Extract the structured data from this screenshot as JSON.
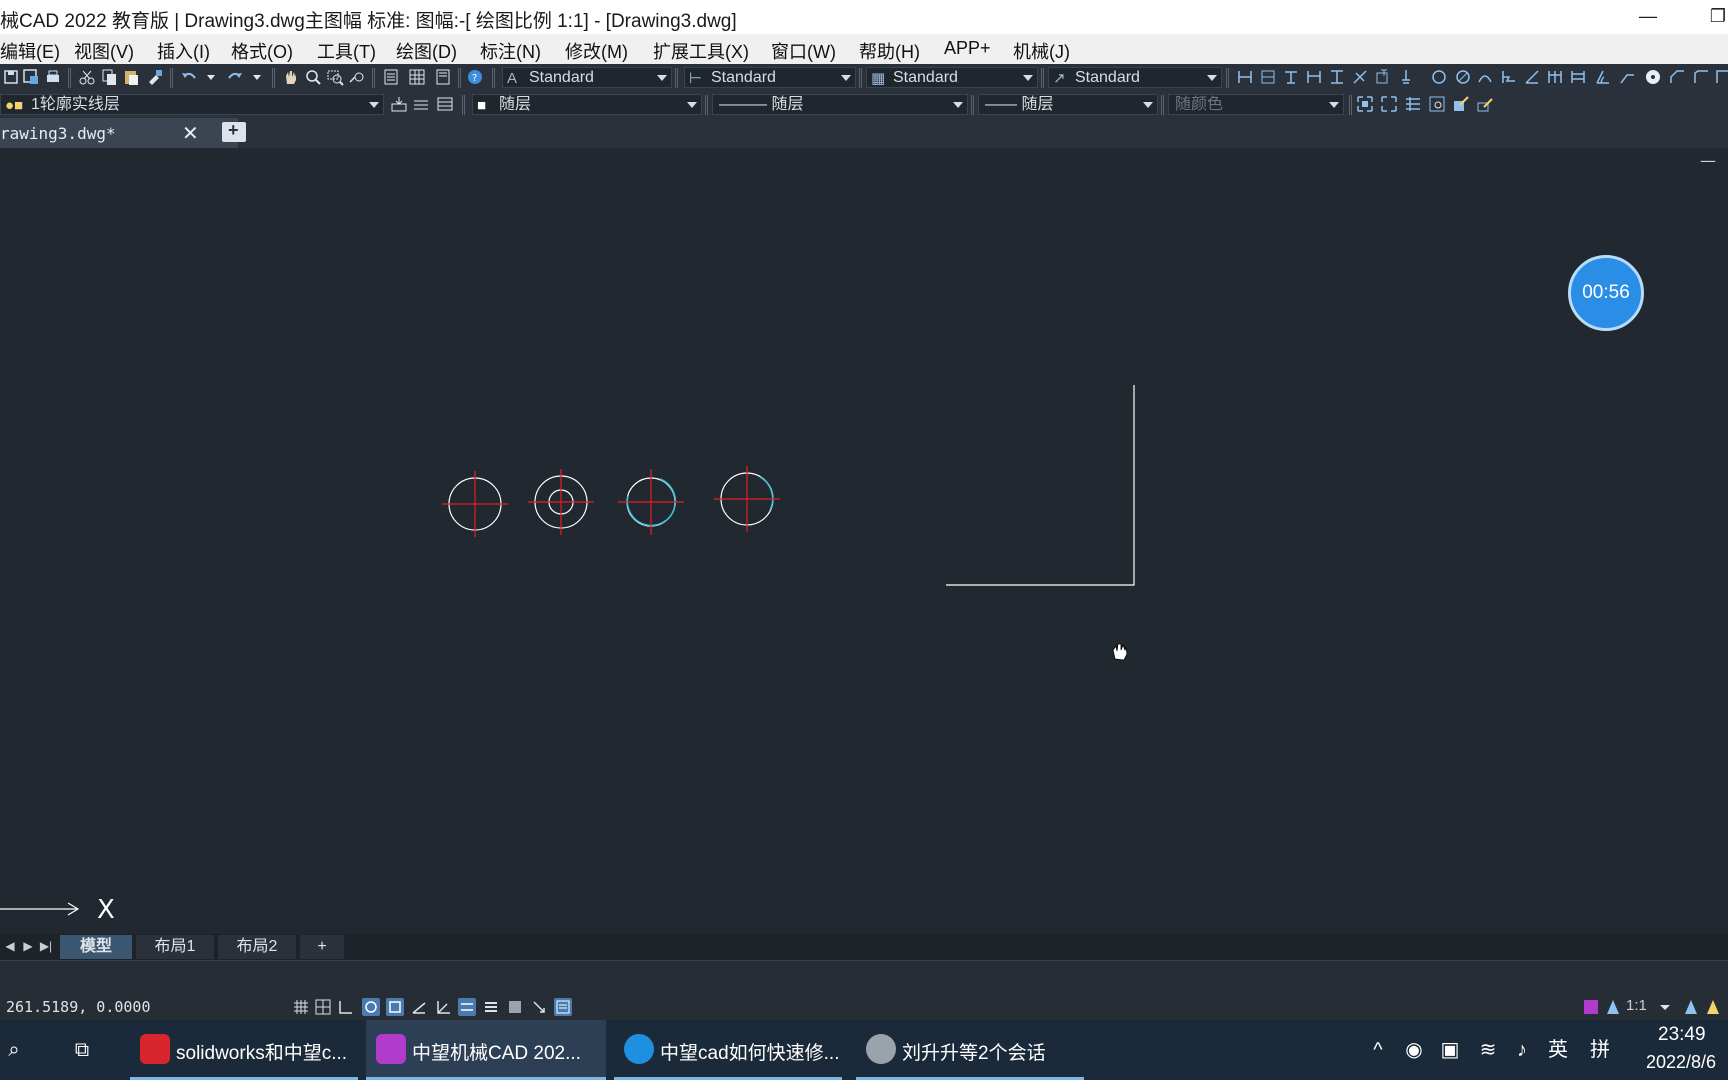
{
  "window": {
    "title": "械CAD 2022 教育版 | Drawing3.dwg主图幅  标准: 图幅:-[ 绘图比例 1:1] - [Drawing3.dwg]",
    "minimize": "—",
    "restore": "❐"
  },
  "menu": [
    "编辑(E)",
    "视图(V)",
    "插入(I)",
    "格式(O)",
    "工具(T)",
    "绘图(D)",
    "标注(N)",
    "修改(M)",
    "扩展工具(X)",
    "窗口(W)",
    "帮助(H)",
    "APP+",
    "机械(J)"
  ],
  "toolbar1": {
    "text_style": "Standard",
    "dim_style": "Standard",
    "table_style": "Standard",
    "multileader_style": "Standard"
  },
  "toolbar2": {
    "layer": "1轮廓实线层",
    "color": "随层",
    "linetype": "——— 随层",
    "lineweight": "—— 随层",
    "plotstyle": "随颜色"
  },
  "doc_tab": {
    "name": "rawing3.dwg*",
    "close": "✕"
  },
  "canvas": {
    "timer": "00:56",
    "axis_label": "X",
    "colors": {
      "background": "#212830",
      "geometry": "#ffffff",
      "centerline": "#e0202a",
      "highlight": "#39c2d7"
    },
    "min_button": "—"
  },
  "layout_tabs": [
    "模型",
    "布局1",
    "布局2",
    "+"
  ],
  "status": {
    "coords": "261.5189,  0.0000",
    "scale": "1:1"
  },
  "taskbar": {
    "items": [
      {
        "label": "solidworks和中望c...",
        "color": "#d9262c"
      },
      {
        "label": "中望机械CAD 202...",
        "color": "#b03ccc"
      },
      {
        "label": "中望cad如何快速修...",
        "color": "#1f8fe0"
      },
      {
        "label": "刘升升等2个会话",
        "color": "#9aa3ab"
      }
    ],
    "ime": "英",
    "ime_mode": "拼",
    "time": "23:49",
    "date": "2022/8/6"
  }
}
